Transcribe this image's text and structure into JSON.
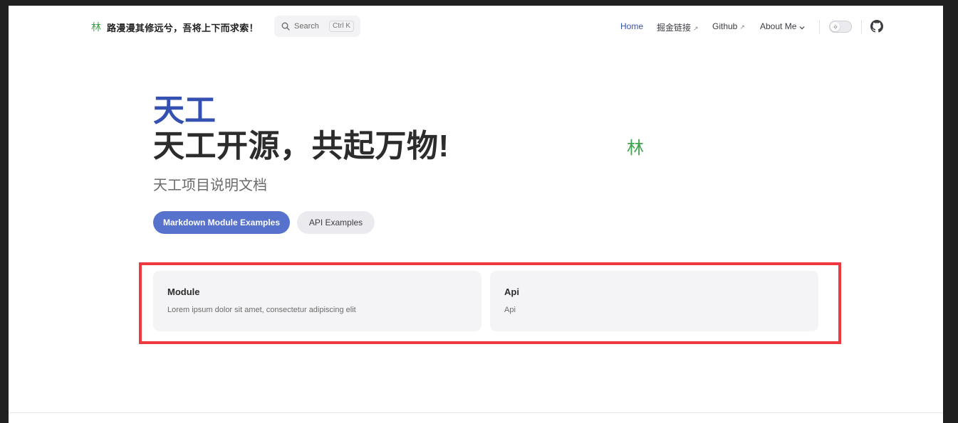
{
  "nav": {
    "logo_mark": "林",
    "title": "路漫漫其修远兮，吾将上下而求索！",
    "search": {
      "label": "Search",
      "shortcut": "Ctrl K"
    },
    "menu": [
      {
        "label": "Home",
        "external": false,
        "active": true
      },
      {
        "label": "掘金链接",
        "external": true
      },
      {
        "label": "Github",
        "external": true
      },
      {
        "label": "About Me",
        "dropdown": true
      }
    ],
    "external_symbol": "↗"
  },
  "hero": {
    "name": "天工",
    "text": "天工开源，共起万物!",
    "tagline": "天工项目说明文档",
    "image_glyph": "林",
    "actions": [
      {
        "label": "Markdown Module Examples",
        "theme": "brand"
      },
      {
        "label": "API Examples",
        "theme": "alt"
      }
    ]
  },
  "features": [
    {
      "title": "Module",
      "details": "Lorem ipsum dolor sit amet, consectetur adipiscing elit"
    },
    {
      "title": "Api",
      "details": "Api"
    }
  ],
  "colors": {
    "brand": "#3451b2",
    "brand_button": "#5672cd",
    "highlight": "#ee3a3f",
    "logo_green": "#3fa34d"
  }
}
